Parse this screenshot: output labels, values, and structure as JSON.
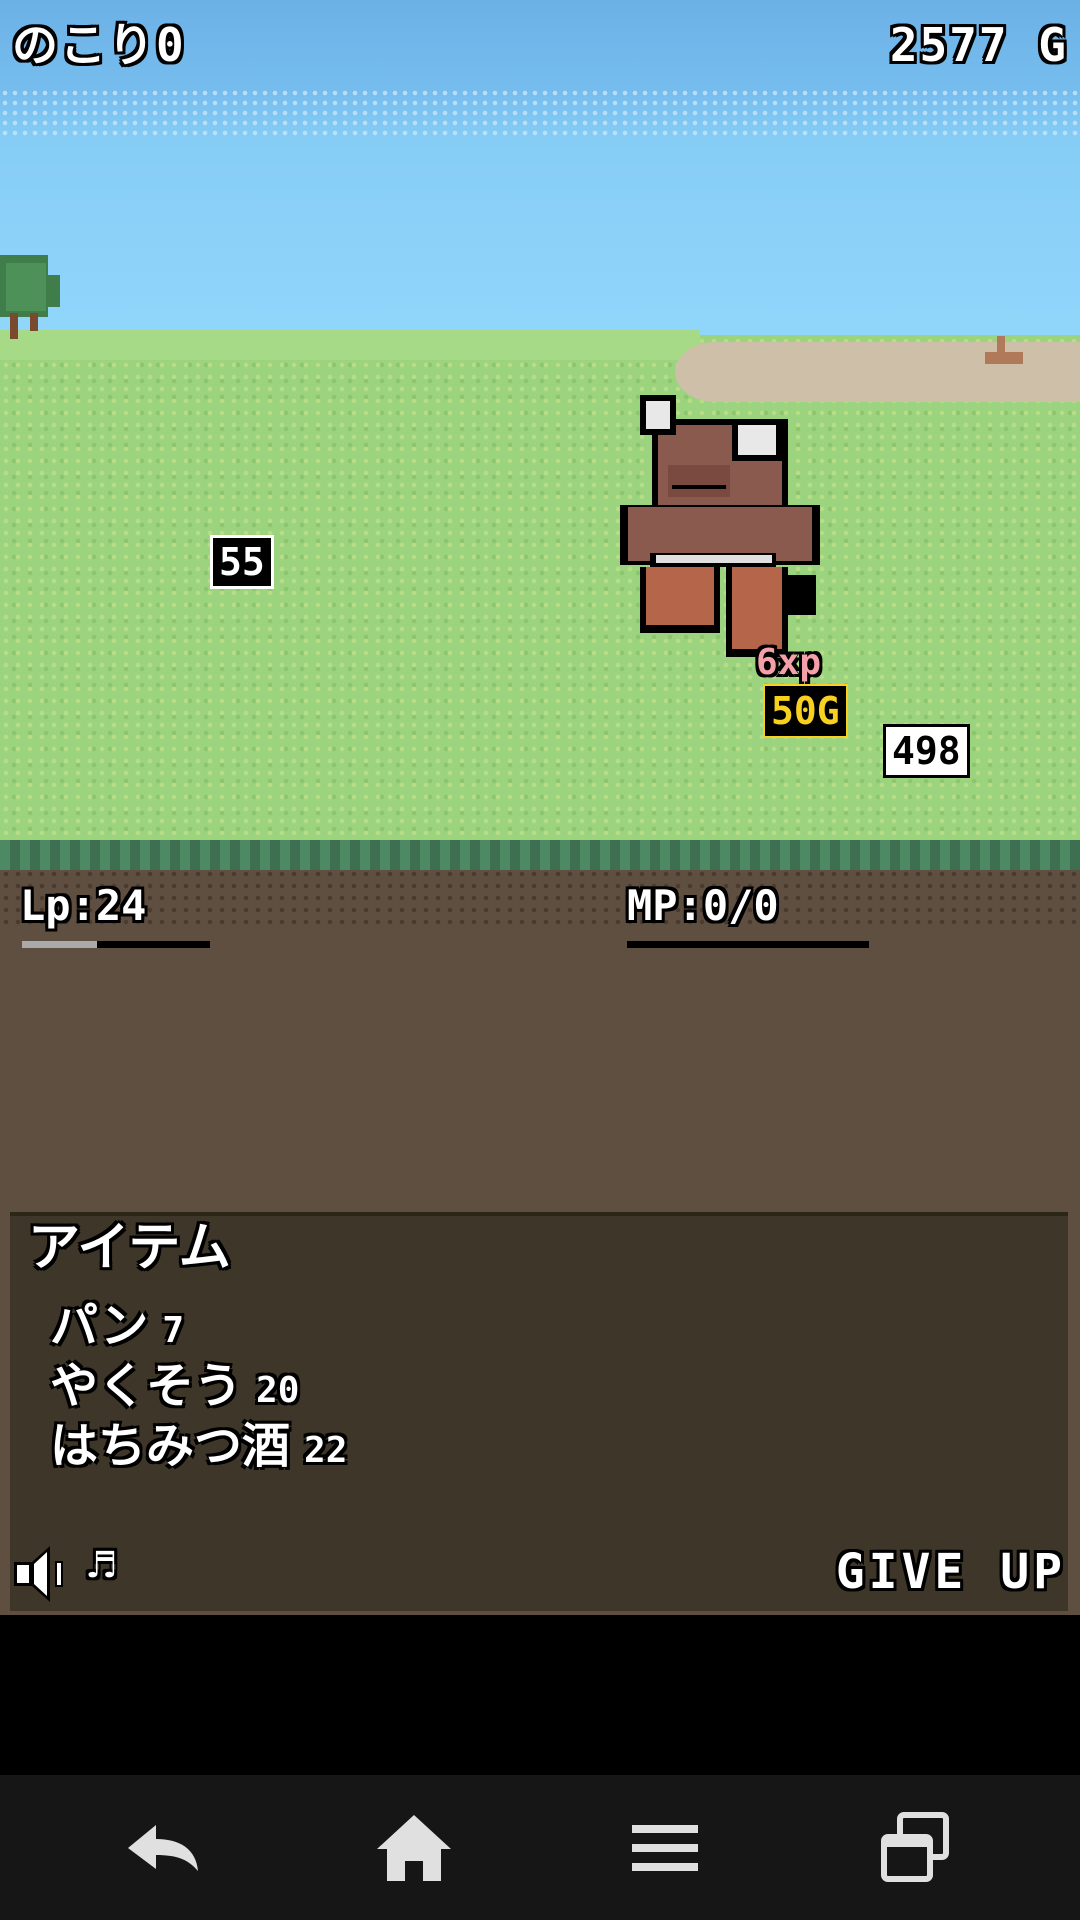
{
  "hud": {
    "remaining_label": "のこり0",
    "gold_total": "2577 G"
  },
  "battle": {
    "damage_left": "55",
    "damage_right": "498",
    "exp_reward": "6xp",
    "gold_reward": "50G",
    "monster_name": "minotaur"
  },
  "stats": {
    "lp_label": "Lp:24",
    "lp_fill_fraction": 0.4,
    "mp_label": "MP:0/0",
    "mp_fill_fraction": 0.0
  },
  "item_menu": {
    "title": "アイテム",
    "items": [
      {
        "name": "パン",
        "qty": "7"
      },
      {
        "name": "やくそう",
        "qty": "20"
      },
      {
        "name": "はちみつ酒",
        "qty": "22"
      }
    ]
  },
  "controls": {
    "speaker_icon": "speaker-icon",
    "music_label": "♬",
    "give_up_label": "GIVE UP"
  },
  "navbar": {
    "icons": [
      "back-icon",
      "home-icon",
      "menu-icon",
      "recent-apps-icon"
    ]
  },
  "colors": {
    "sky": "#86cdf6",
    "grass": "#9cd37e",
    "dirt": "#5f4f41",
    "panel": "#3e3628",
    "gold": "#f8d020",
    "exp": "#f4a0aa"
  }
}
